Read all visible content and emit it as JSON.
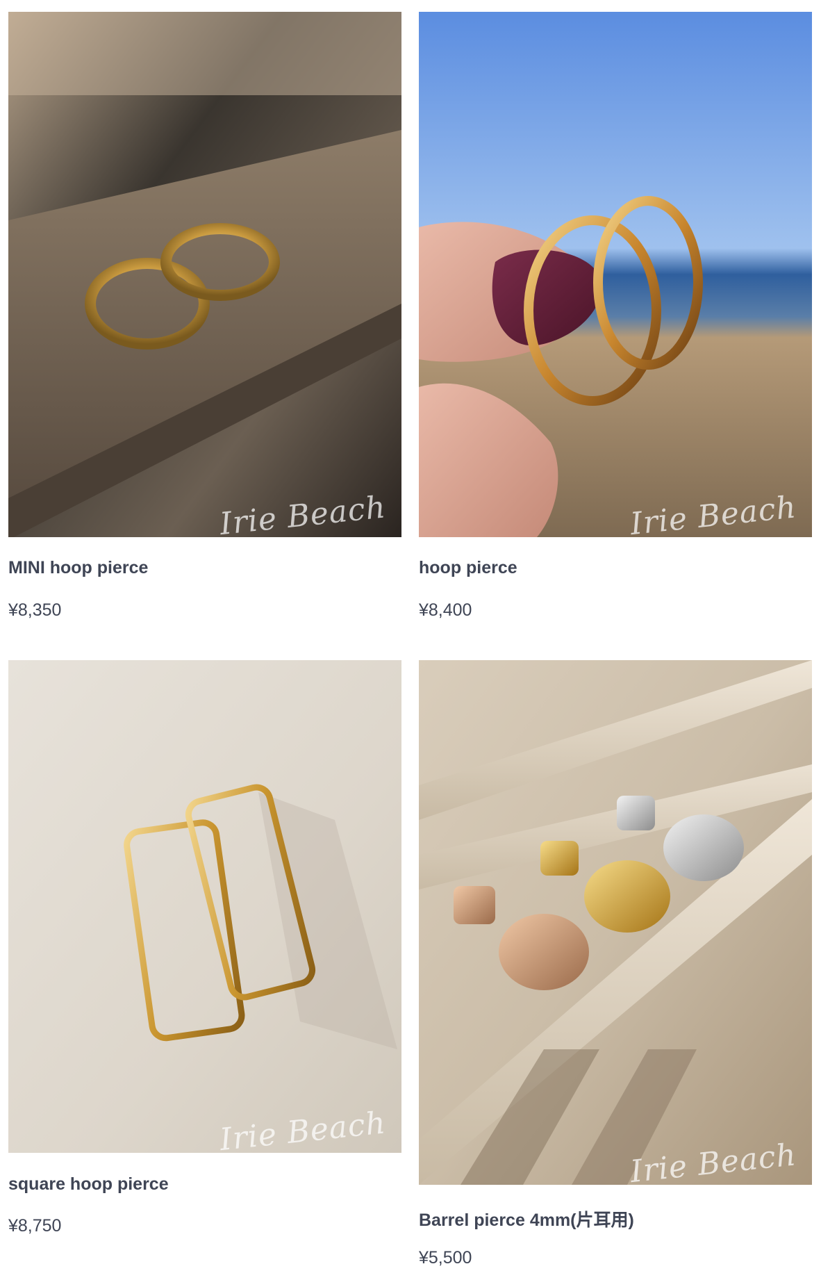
{
  "products": [
    {
      "name": "MINI hoop pierce",
      "price": "¥8,350",
      "watermark": "Irie Beach",
      "image_icon": "earring-photo-sand"
    },
    {
      "name": "hoop pierce",
      "price": "¥8,400",
      "watermark": "Irie Beach",
      "image_icon": "earring-photo-hand-beach"
    },
    {
      "name": "square hoop pierce",
      "price": "¥8,750",
      "watermark": "Irie Beach",
      "image_icon": "earring-photo-square"
    },
    {
      "name": "Barrel pierce 4mm(片耳用)",
      "price": "¥5,500",
      "watermark": "Irie Beach",
      "image_icon": "earring-photo-barrel"
    }
  ]
}
